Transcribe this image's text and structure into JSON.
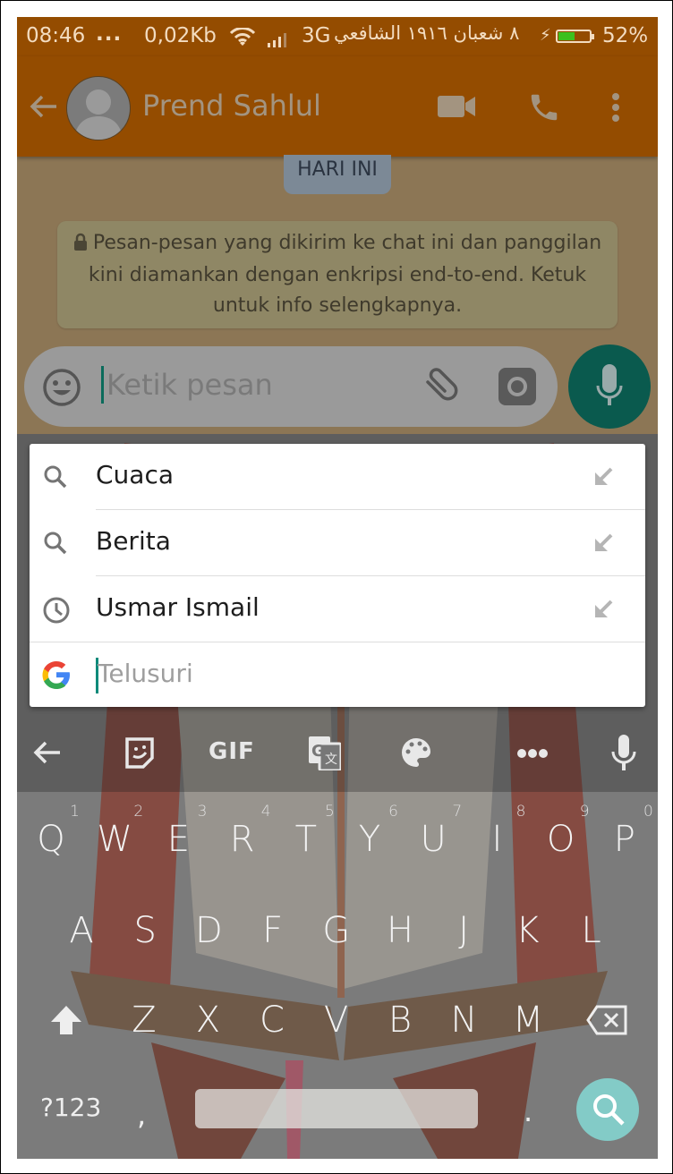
{
  "status_bar": {
    "time": "08:46",
    "notification_dots": "...",
    "net_speed": "0,02Kb",
    "network_type": "3G",
    "hijri_date": "٨ شعبان ١٩١٦ الشافعي",
    "battery_percent": "52%",
    "battery_level": 0.52,
    "charging": true
  },
  "app_bar": {
    "contact_name": "Prend Sahlul",
    "icons": [
      "back-arrow-icon",
      "avatar",
      "video-call-icon",
      "phone-icon",
      "more-vert-icon"
    ]
  },
  "chat": {
    "date_chip": "HARI INI",
    "encryption_notice": "Pesan-pesan yang dikirim ke chat ini dan panggilan kini diamankan dengan enkripsi end-to-end. Ketuk untuk info selengkapnya."
  },
  "composer": {
    "placeholder": "Ketik pesan",
    "value": ""
  },
  "search_suggestions": {
    "items": [
      {
        "label": "Cuaca",
        "icon": "search-icon"
      },
      {
        "label": "Berita",
        "icon": "search-icon"
      },
      {
        "label": "Usmar Ismail",
        "icon": "history-icon"
      }
    ],
    "search_placeholder": "Telusuri",
    "search_value": ""
  },
  "keyboard": {
    "toolbar": {
      "gif_label": "GIF",
      "icons": [
        "back-arrow-icon",
        "sticker-icon",
        "gif-icon",
        "translate-icon",
        "palette-icon",
        "more-icon",
        "mic-icon"
      ]
    },
    "row1": [
      {
        "key": "Q",
        "hint": "1"
      },
      {
        "key": "W",
        "hint": "2"
      },
      {
        "key": "E",
        "hint": "3"
      },
      {
        "key": "R",
        "hint": "4"
      },
      {
        "key": "T",
        "hint": "5"
      },
      {
        "key": "Y",
        "hint": "6"
      },
      {
        "key": "U",
        "hint": "7"
      },
      {
        "key": "I",
        "hint": "8"
      },
      {
        "key": "O",
        "hint": "9"
      },
      {
        "key": "P",
        "hint": "0"
      }
    ],
    "row2": [
      "A",
      "S",
      "D",
      "F",
      "G",
      "H",
      "J",
      "K",
      "L"
    ],
    "row3": [
      "Z",
      "X",
      "C",
      "V",
      "B",
      "N",
      "M"
    ],
    "symbols_label": "?123",
    "comma": ",",
    "period": ".",
    "accent_color": "#83cbc7"
  },
  "colors": {
    "app_bar": "#944c00",
    "mic_button": "#0a5a4e",
    "cursor": "#0d8a7a"
  }
}
